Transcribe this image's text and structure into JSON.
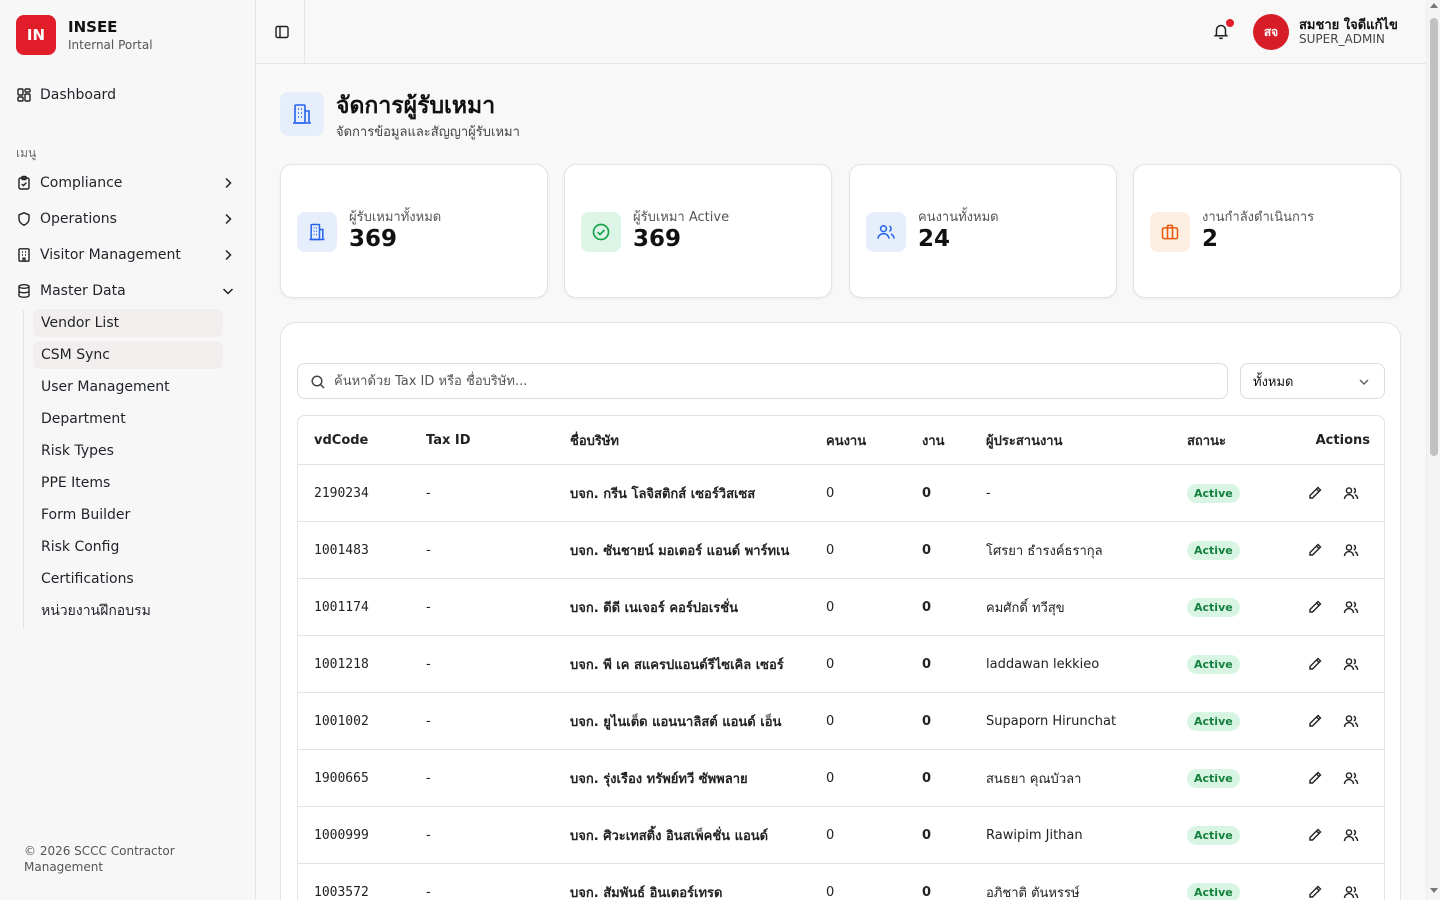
{
  "brand": {
    "logo": "IN",
    "name": "INSEE",
    "subtitle": "Internal Portal"
  },
  "sidebar": {
    "dashboard": {
      "label": "Dashboard",
      "icon": "layout-grid-icon"
    },
    "section_label": "เมนู",
    "groups": [
      {
        "label": "Compliance",
        "icon": "clipboard-check-icon",
        "expanded": false
      },
      {
        "label": "Operations",
        "icon": "shield-icon",
        "expanded": false
      },
      {
        "label": "Visitor Management",
        "icon": "building-icon",
        "expanded": false
      },
      {
        "label": "Master Data",
        "icon": "database-icon",
        "expanded": true
      }
    ],
    "sub_items": [
      {
        "label": "Vendor List",
        "active": true
      },
      {
        "label": "CSM Sync",
        "active": true
      },
      {
        "label": "User Management",
        "active": false
      },
      {
        "label": "Department",
        "active": false
      },
      {
        "label": "Risk Types",
        "active": false
      },
      {
        "label": "PPE Items",
        "active": false
      },
      {
        "label": "Form Builder",
        "active": false
      },
      {
        "label": "Risk Config",
        "active": false
      },
      {
        "label": "Certifications",
        "active": false
      },
      {
        "label": "หน่วยงานฝึกอบรม",
        "active": false
      }
    ],
    "footer": "© 2026 SCCC Contractor Management"
  },
  "topbar": {
    "avatar_initials": "สจ",
    "user_name": "สมชาย ใจดีแก้ไข",
    "user_role": "SUPER_ADMIN",
    "has_notification": true
  },
  "page": {
    "title": "จัดการผู้รับเหมา",
    "subtitle": "จัดการข้อมูลและสัญญาผู้รับเหมา"
  },
  "stats": [
    {
      "label": "ผู้รับเหมาทั้งหมด",
      "value": "369",
      "icon": "building-icon",
      "color": "#2563eb",
      "bg": "#e6edfb"
    },
    {
      "label": "ผู้รับเหมา Active",
      "value": "369",
      "icon": "check-circle-icon",
      "color": "#16a34a",
      "bg": "#dcf5e6"
    },
    {
      "label": "คนงานทั้งหมด",
      "value": "24",
      "icon": "users-icon",
      "color": "#2563eb",
      "bg": "#e6edfb"
    },
    {
      "label": "งานกำลังดำเนินการ",
      "value": "2",
      "icon": "briefcase-icon",
      "color": "#ea580c",
      "bg": "#fdeee2"
    }
  ],
  "search": {
    "placeholder": "ค้นหาด้วย Tax ID หรือ ชื่อบริษัท...",
    "value": ""
  },
  "filter": {
    "selected": "ทั้งหมด"
  },
  "table": {
    "headers": [
      "vdCode",
      "Tax ID",
      "ชื่อบริษัท",
      "คนงาน",
      "งาน",
      "ผู้ประสานงาน",
      "สถานะ",
      "Actions"
    ],
    "rows": [
      {
        "vdCode": "2190234",
        "taxId": "-",
        "company": "บจก. กรีน โลจิสติกส์ เซอร์วิสเซส",
        "workers": "0",
        "jobs": "0",
        "coordinator": "-",
        "status": "Active"
      },
      {
        "vdCode": "1001483",
        "taxId": "-",
        "company": "บจก. ซันชายน์ มอเตอร์ แอนด์ พาร์ทเน",
        "workers": "0",
        "jobs": "0",
        "coordinator": "โศรยา ธำรงค์ธรากุล",
        "status": "Active"
      },
      {
        "vdCode": "1001174",
        "taxId": "-",
        "company": "บจก. ดีดี เนเจอร์ คอร์ปอเรชั่น",
        "workers": "0",
        "jobs": "0",
        "coordinator": "คมศักดิ์ ทวีสุข",
        "status": "Active"
      },
      {
        "vdCode": "1001218",
        "taxId": "-",
        "company": "บจก. พี เค สแครปแอนด์รีไซเคิล เซอร์",
        "workers": "0",
        "jobs": "0",
        "coordinator": "laddawan lekkieo",
        "status": "Active"
      },
      {
        "vdCode": "1001002",
        "taxId": "-",
        "company": "บจก. ยูไนเต็ด แอนนาลิสต์ แอนด์ เอ็น",
        "workers": "0",
        "jobs": "0",
        "coordinator": "Supaporn Hirunchat",
        "status": "Active"
      },
      {
        "vdCode": "1900665",
        "taxId": "-",
        "company": "บจก. รุ่งเรือง ทรัพย์ทวี ซัพพลาย",
        "workers": "0",
        "jobs": "0",
        "coordinator": "สนธยา คุณบัวลา",
        "status": "Active"
      },
      {
        "vdCode": "1000999",
        "taxId": "-",
        "company": "บจก. ศิวะเทสติ้ง อินสเพ็คชั่น แอนด์",
        "workers": "0",
        "jobs": "0",
        "coordinator": "Rawipim Jithan",
        "status": "Active"
      },
      {
        "vdCode": "1003572",
        "taxId": "-",
        "company": "บจก. สัมพันธ์ อินเตอร์เทรด",
        "workers": "0",
        "jobs": "0",
        "coordinator": "อภิชาติ ตันหรรษ์",
        "status": "Active"
      }
    ]
  }
}
